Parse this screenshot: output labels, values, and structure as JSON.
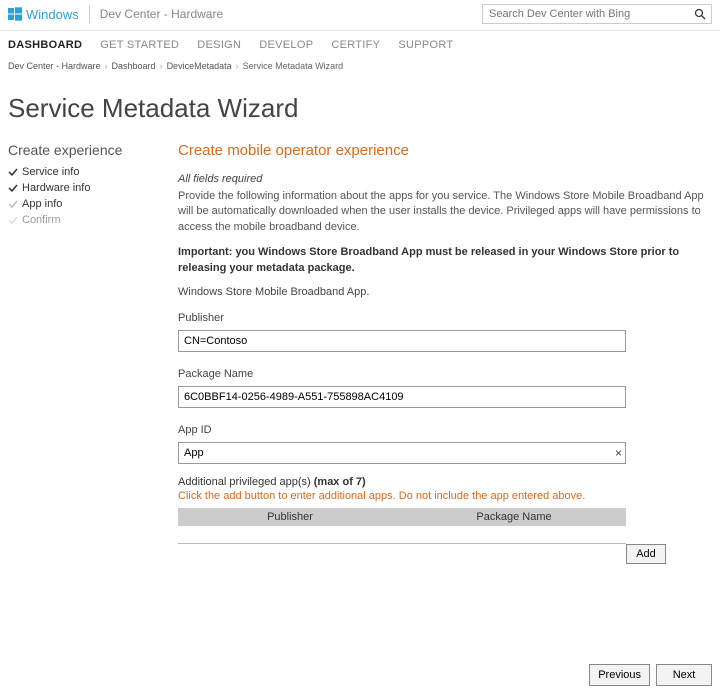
{
  "header": {
    "logo_text": "Windows",
    "hardware_label": "Dev Center - Hardware",
    "search_placeholder": "Search Dev Center with Bing"
  },
  "nav": {
    "items": [
      "DASHBOARD",
      "GET STARTED",
      "DESIGN",
      "DEVELOP",
      "CERTIFY",
      "SUPPORT"
    ],
    "active_index": 0
  },
  "breadcrumb": {
    "items": [
      "Dev Center - Hardware",
      "Dashboard",
      "DeviceMetadata",
      "Service Metadata Wizard"
    ]
  },
  "page": {
    "title": "Service Metadata Wizard"
  },
  "sidebar": {
    "title": "Create experience",
    "steps": [
      {
        "label": "Service info",
        "state": "done"
      },
      {
        "label": "Hardware info",
        "state": "done"
      },
      {
        "label": "App info",
        "state": "current"
      },
      {
        "label": "Confirm",
        "state": "pending"
      }
    ]
  },
  "form": {
    "section_title": "Create mobile operator experience",
    "required_note": "All fields required",
    "intro": "Provide the following information about the apps for you service. The Windows Store Mobile Broadband App will be automatically downloaded when the user installs the device. Privileged apps will have permissions to access the mobile broadband device.",
    "important": "Important: you Windows Store Broadband App must be released in your Windows Store prior to releasing your metadata package.",
    "subnote": "Windows Store Mobile Broadband App.",
    "publisher_label": "Publisher",
    "publisher_value": "CN=Contoso",
    "package_label": "Package Name",
    "package_value": "6C0BBF14-0256-4989-A551-755898AC4109",
    "appid_label": "App ID",
    "appid_value": "App",
    "addl_label_pre": "Additional privileged app(s) ",
    "addl_label_max": "(max of 7)",
    "addl_hint": "Click the add button to enter additional apps. Do not include the app entered above.",
    "table_headers": {
      "publisher": "Publisher",
      "package": "Package Name"
    },
    "add_button": "Add"
  },
  "footer": {
    "previous": "Previous",
    "next": "Next"
  }
}
